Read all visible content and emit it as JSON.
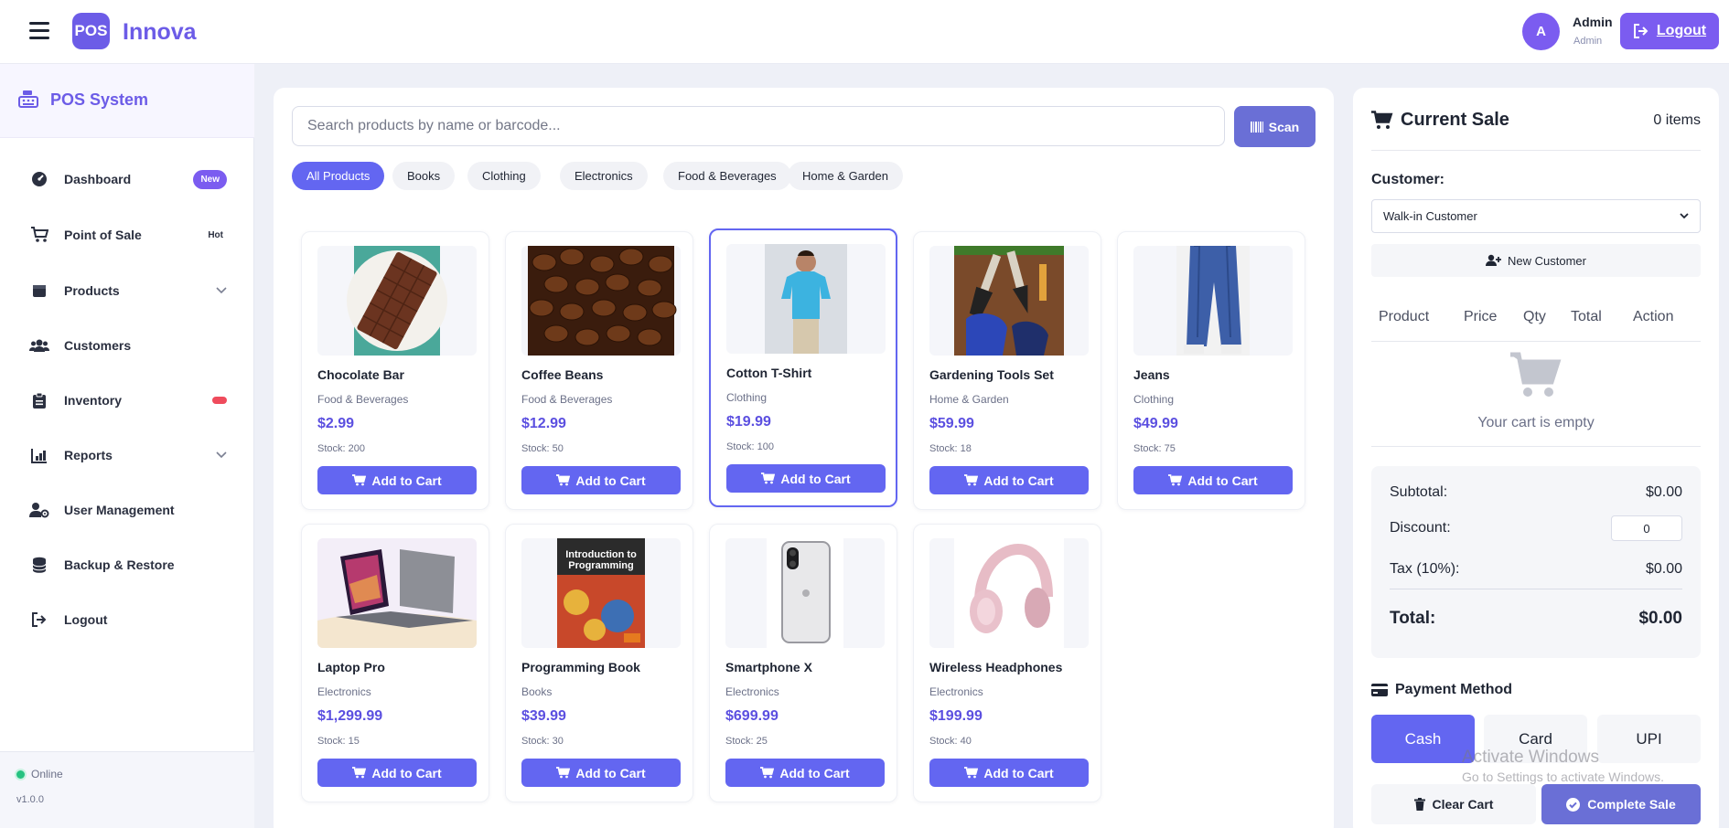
{
  "header": {
    "logo_text": "POS",
    "brand": "Innova",
    "avatar_letter": "A",
    "user_name": "Admin",
    "user_role": "Admin",
    "logout_label": "Logout"
  },
  "sidebar": {
    "title": "POS System",
    "items": [
      {
        "label": "Dashboard",
        "icon": "dashboard-icon",
        "badge": "New"
      },
      {
        "label": "Point of Sale",
        "icon": "cart-icon",
        "badge": "Hot"
      },
      {
        "label": "Products",
        "icon": "box-icon"
      },
      {
        "label": "Customers",
        "icon": "users-icon"
      },
      {
        "label": "Inventory",
        "icon": "clipboard-icon"
      },
      {
        "label": "Reports",
        "icon": "chart-icon"
      },
      {
        "label": "User Management",
        "icon": "user-cog-icon"
      },
      {
        "label": "Backup & Restore",
        "icon": "database-icon"
      },
      {
        "label": "Logout",
        "icon": "logout-icon"
      }
    ],
    "status": "Online",
    "version": "v1.0.0"
  },
  "search": {
    "placeholder": "Search products by name or barcode...",
    "scan_label": "Scan"
  },
  "filters": [
    "All Products",
    "Books",
    "Clothing",
    "Electronics",
    "Food & Beverages",
    "Home & Garden"
  ],
  "add_to_cart_label": "Add to Cart",
  "products": [
    {
      "name": "Chocolate Bar",
      "category": "Food & Beverages",
      "price": "$2.99",
      "stock": "Stock: 200"
    },
    {
      "name": "Coffee Beans",
      "category": "Food & Beverages",
      "price": "$12.99",
      "stock": "Stock: 50"
    },
    {
      "name": "Cotton T-Shirt",
      "category": "Clothing",
      "price": "$19.99",
      "stock": "Stock: 100"
    },
    {
      "name": "Gardening Tools Set",
      "category": "Home & Garden",
      "price": "$59.99",
      "stock": "Stock: 18"
    },
    {
      "name": "Jeans",
      "category": "Clothing",
      "price": "$49.99",
      "stock": "Stock: 75"
    },
    {
      "name": "Laptop Pro",
      "category": "Electronics",
      "price": "$1,299.99",
      "stock": "Stock: 15"
    },
    {
      "name": "Programming Book",
      "category": "Books",
      "price": "$39.99",
      "stock": "Stock: 30",
      "cover_text": "Introduction to Programming"
    },
    {
      "name": "Smartphone X",
      "category": "Electronics",
      "price": "$699.99",
      "stock": "Stock: 25"
    },
    {
      "name": "Wireless Headphones",
      "category": "Electronics",
      "price": "$199.99",
      "stock": "Stock: 40"
    }
  ],
  "cart": {
    "title": "Current Sale",
    "count": "0 items",
    "customer_label": "Customer:",
    "customer_value": "Walk-in Customer",
    "new_customer_label": "New Customer",
    "columns": [
      "Product",
      "Price",
      "Qty",
      "Total",
      "Action"
    ],
    "empty_text": "Your cart is empty",
    "subtotal_label": "Subtotal:",
    "subtotal_value": "$0.00",
    "discount_label": "Discount:",
    "discount_value": "0",
    "tax_label": "Tax (10%):",
    "tax_value": "$0.00",
    "total_label": "Total:",
    "total_value": "$0.00",
    "payment_title": "Payment Method",
    "payment_methods": [
      "Cash",
      "Card",
      "UPI"
    ],
    "clear_label": "Clear Cart",
    "complete_label": "Complete Sale"
  },
  "watermark": {
    "line1": "Activate Windows",
    "line2": "Go to Settings to activate Windows."
  },
  "colors": {
    "accent": "#6366f1",
    "brand": "#6c5ce7",
    "online": "#26c281",
    "alert": "#ef4b5c"
  }
}
